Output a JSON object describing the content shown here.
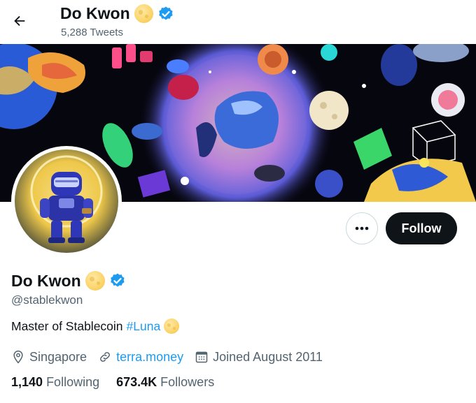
{
  "header": {
    "name": "Do Kwon",
    "tweets_count": "5,288 Tweets"
  },
  "profile": {
    "name": "Do Kwon",
    "handle": "@stablekwon",
    "bio_text": "Master of Stablecoin",
    "bio_hashtag": "#Luna",
    "location": "Singapore",
    "website": "terra.money",
    "joined": "Joined August 2011"
  },
  "actions": {
    "follow_label": "Follow",
    "more_label": "•••"
  },
  "stats": {
    "following_count": "1,140",
    "following_label": "Following",
    "followers_count": "673.4K",
    "followers_label": "Followers"
  },
  "icons": {
    "back": "arrow-left-icon",
    "verified": "verified-badge-icon",
    "moon": "moon-emoji-icon",
    "location": "location-pin-icon",
    "link": "link-icon",
    "calendar": "calendar-icon",
    "more": "more-dots-icon"
  },
  "colors": {
    "accent": "#1d9bf0",
    "text_primary": "#0f1419",
    "text_secondary": "#536471",
    "follow_button_bg": "#0f1419"
  }
}
